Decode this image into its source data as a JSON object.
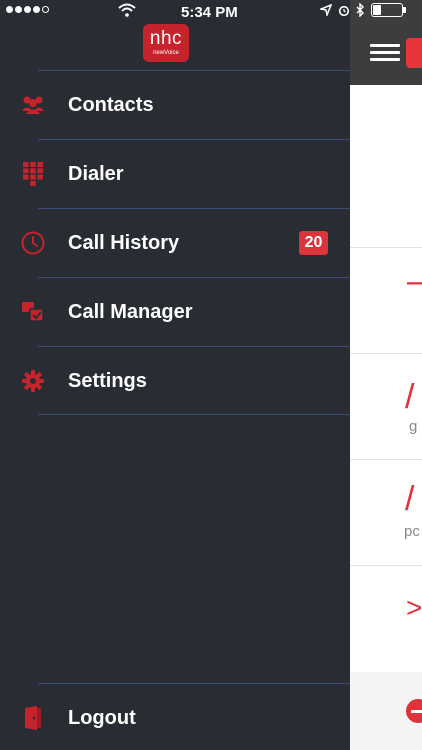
{
  "status_bar": {
    "time": "5:34 PM",
    "signal": "signal-dots",
    "wifi": "wifi-icon",
    "location": "location-arrow-icon",
    "alarm": "alarm-icon",
    "bluetooth": "bluetooth-icon",
    "battery": "battery-icon"
  },
  "logo": {
    "brand": "nhc",
    "sub": "newVoice"
  },
  "menu": {
    "items": [
      {
        "label": "Contacts",
        "icon": "contacts-icon"
      },
      {
        "label": "Dialer",
        "icon": "dialpad-icon"
      },
      {
        "label": "Call History",
        "icon": "clock-icon",
        "badge": "20"
      },
      {
        "label": "Call Manager",
        "icon": "call-manager-icon"
      },
      {
        "label": "Settings",
        "icon": "gear-icon"
      }
    ],
    "logout": {
      "label": "Logout",
      "icon": "logout-door-icon"
    }
  },
  "background_content": {
    "snippets": [
      "g",
      "pc"
    ]
  },
  "colors": {
    "drawer_bg": "#292c33",
    "accent_red": "#d9353b",
    "separator": "#3d4d7a",
    "header_bg": "#3d3d3f"
  }
}
